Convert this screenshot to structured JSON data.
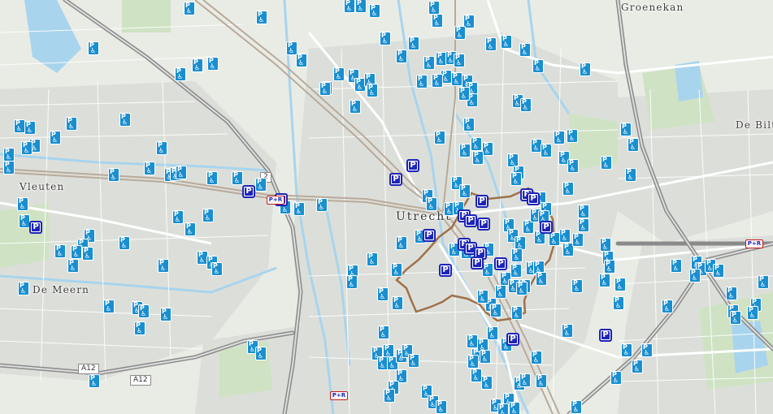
{
  "map": {
    "place_labels": {
      "groenekan": "Groenekan",
      "de_bilt": "De Bilt",
      "vleuten": "Vleuten",
      "utrecht": "Utrecht",
      "de_meern": "De Meern"
    },
    "road_labels": {
      "a12_west": "A12",
      "a12_south": "A12",
      "a2_fragment": "2"
    },
    "marker_legend": {
      "disabled_parking_icon": "P ♿",
      "garage_icon": "P",
      "park_ride_icon": "P+R"
    },
    "colors": {
      "disabled_parking": "#1a8fd0",
      "parking_garage": "#1d24b8",
      "park_and_ride_border": "#c21a1a",
      "centre_boundary": "#a0714b",
      "water": "#a8d4ee",
      "highway": "#8a8a8a",
      "railway": "#b9aa9a"
    }
  }
}
